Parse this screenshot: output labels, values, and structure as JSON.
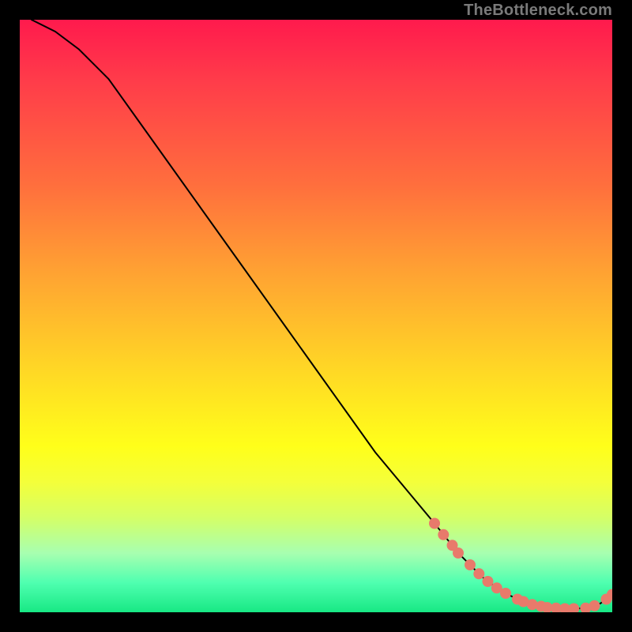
{
  "watermark": "TheBottleneck.com",
  "chart_data": {
    "type": "line",
    "title": "",
    "xlabel": "",
    "ylabel": "",
    "xlim": [
      0,
      100
    ],
    "ylim": [
      0,
      100
    ],
    "grid": false,
    "series": [
      {
        "name": "bottleneck-curve",
        "x": [
          2,
          6,
          10,
          15,
          20,
          25,
          30,
          35,
          40,
          45,
          50,
          55,
          60,
          65,
          70,
          74,
          78,
          80,
          82,
          84,
          86,
          88,
          90,
          92,
          94,
          96,
          98,
          100
        ],
        "y": [
          100,
          98,
          95,
          90,
          83,
          76,
          69,
          62,
          55,
          48,
          41,
          34,
          27,
          21,
          15,
          10,
          6,
          4.5,
          3.2,
          2.2,
          1.5,
          1.0,
          0.7,
          0.6,
          0.6,
          0.8,
          1.5,
          3.0
        ]
      }
    ],
    "markers": {
      "name": "highlighted-points",
      "color": "#e87a6b",
      "points": [
        {
          "x": 70.0,
          "y": 15.0
        },
        {
          "x": 71.5,
          "y": 13.1
        },
        {
          "x": 73.0,
          "y": 11.3
        },
        {
          "x": 74.0,
          "y": 10.0
        },
        {
          "x": 76.0,
          "y": 8.0
        },
        {
          "x": 77.5,
          "y": 6.5
        },
        {
          "x": 79.0,
          "y": 5.2
        },
        {
          "x": 80.5,
          "y": 4.1
        },
        {
          "x": 82.0,
          "y": 3.2
        },
        {
          "x": 84.0,
          "y": 2.2
        },
        {
          "x": 85.0,
          "y": 1.8
        },
        {
          "x": 86.5,
          "y": 1.3
        },
        {
          "x": 88.0,
          "y": 1.0
        },
        {
          "x": 89.0,
          "y": 0.8
        },
        {
          "x": 90.5,
          "y": 0.7
        },
        {
          "x": 92.0,
          "y": 0.6
        },
        {
          "x": 93.5,
          "y": 0.6
        },
        {
          "x": 95.5,
          "y": 0.7
        },
        {
          "x": 97.0,
          "y": 1.1
        },
        {
          "x": 99.0,
          "y": 2.2
        },
        {
          "x": 100.0,
          "y": 3.0
        }
      ]
    }
  }
}
